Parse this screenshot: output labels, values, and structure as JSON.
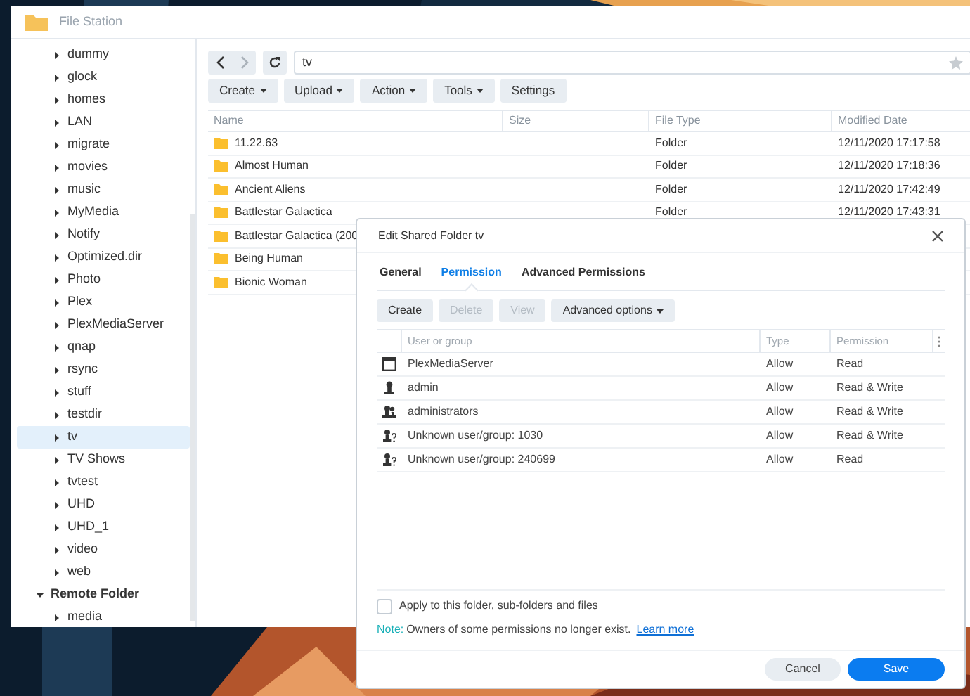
{
  "window": {
    "title": "File Station"
  },
  "sidebar": {
    "items": [
      {
        "label": "dummy",
        "selected": false
      },
      {
        "label": "glock",
        "selected": false
      },
      {
        "label": "homes",
        "selected": false
      },
      {
        "label": "LAN",
        "selected": false
      },
      {
        "label": "migrate",
        "selected": false
      },
      {
        "label": "movies",
        "selected": false
      },
      {
        "label": "music",
        "selected": false
      },
      {
        "label": "MyMedia",
        "selected": false
      },
      {
        "label": "Notify",
        "selected": false
      },
      {
        "label": "Optimized.dir",
        "selected": false
      },
      {
        "label": "Photo",
        "selected": false
      },
      {
        "label": "Plex",
        "selected": false
      },
      {
        "label": "PlexMediaServer",
        "selected": false
      },
      {
        "label": "qnap",
        "selected": false
      },
      {
        "label": "rsync",
        "selected": false
      },
      {
        "label": "stuff",
        "selected": false
      },
      {
        "label": "testdir",
        "selected": false
      },
      {
        "label": "tv",
        "selected": true
      },
      {
        "label": "TV Shows",
        "selected": false
      },
      {
        "label": "tvtest",
        "selected": false
      },
      {
        "label": "UHD",
        "selected": false
      },
      {
        "label": "UHD_1",
        "selected": false
      },
      {
        "label": "video",
        "selected": false
      },
      {
        "label": "web",
        "selected": false
      }
    ],
    "remote_folder": {
      "label": "Remote Folder",
      "expanded": true,
      "children": [
        {
          "label": "media",
          "selected": false
        }
      ]
    }
  },
  "toolbar": {
    "back_disabled": false,
    "forward_disabled": true,
    "path": "tv",
    "buttons": [
      {
        "label": "Create",
        "has_menu": true
      },
      {
        "label": "Upload",
        "has_menu": true
      },
      {
        "label": "Action",
        "has_menu": true
      },
      {
        "label": "Tools",
        "has_menu": true
      },
      {
        "label": "Settings",
        "has_menu": false
      }
    ]
  },
  "table": {
    "columns": [
      "Name",
      "Size",
      "File Type",
      "Modified Date"
    ],
    "rows": [
      {
        "name": "11.22.63",
        "type": "Folder",
        "modified": "12/11/2020 17:17:58"
      },
      {
        "name": "Almost Human",
        "type": "Folder",
        "modified": "12/11/2020 17:18:36"
      },
      {
        "name": "Ancient Aliens",
        "type": "Folder",
        "modified": "12/11/2020 17:42:49"
      },
      {
        "name": "Battlestar Galactica",
        "type": "Folder",
        "modified": "12/11/2020 17:43:31"
      },
      {
        "name": "Battlestar Galactica (200",
        "type": "",
        "modified": ""
      },
      {
        "name": "Being Human",
        "type": "",
        "modified": ""
      },
      {
        "name": "Bionic Woman",
        "type": "",
        "modified": ""
      }
    ]
  },
  "dialog": {
    "title": "Edit Shared Folder tv",
    "tabs": [
      {
        "label": "General",
        "selected": false
      },
      {
        "label": "Permission",
        "selected": true
      },
      {
        "label": "Advanced Permissions",
        "selected": false
      }
    ],
    "buttons": [
      {
        "label": "Create",
        "disabled": false,
        "has_menu": false
      },
      {
        "label": "Delete",
        "disabled": true,
        "has_menu": false
      },
      {
        "label": "View",
        "disabled": true,
        "has_menu": false
      },
      {
        "label": "Advanced options",
        "disabled": false,
        "has_menu": true
      }
    ],
    "columns": [
      "User or group",
      "Type",
      "Permission"
    ],
    "rows": [
      {
        "kind": "service",
        "name": "PlexMediaServer",
        "type": "Allow",
        "permission": "Read"
      },
      {
        "kind": "user",
        "name": "admin",
        "type": "Allow",
        "permission": "Read & Write"
      },
      {
        "kind": "group",
        "name": "administrators",
        "type": "Allow",
        "permission": "Read & Write"
      },
      {
        "kind": "unknown",
        "name": "Unknown user/group: 1030",
        "type": "Allow",
        "permission": "Read & Write"
      },
      {
        "kind": "unknown",
        "name": "Unknown user/group: 240699",
        "type": "Allow",
        "permission": "Read"
      }
    ],
    "apply_checkbox": {
      "label": "Apply to this folder, sub-folders and files",
      "checked": false
    },
    "note": {
      "label": "Note:",
      "text": "Owners of some permissions no longer exist.",
      "link": "Learn more"
    },
    "footer_buttons": [
      "Cancel",
      "Save"
    ]
  }
}
